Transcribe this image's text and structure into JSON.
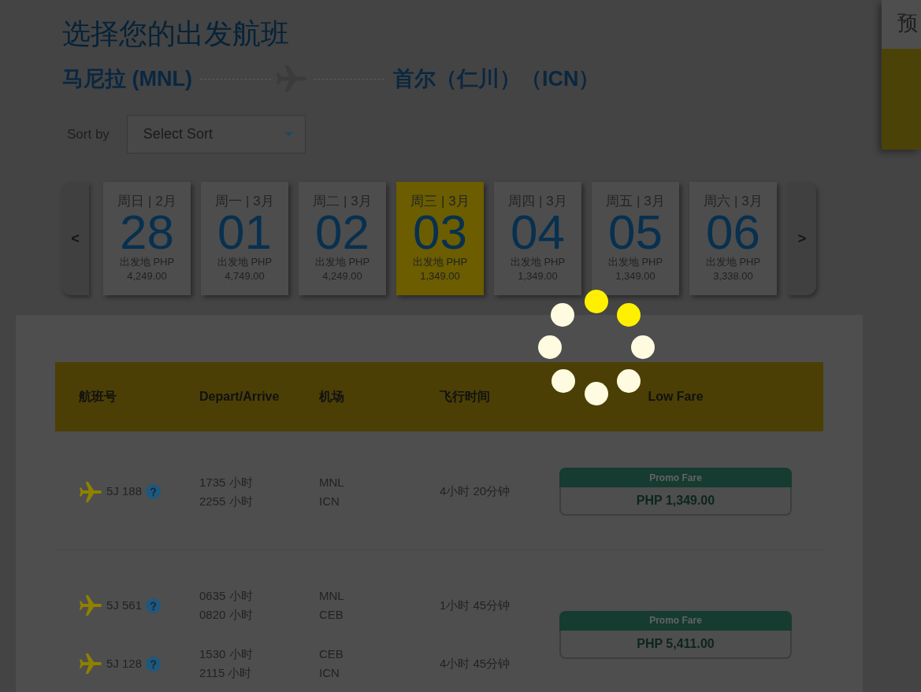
{
  "page_title": "选择您的出发航班",
  "route": {
    "origin": "马尼拉 (MNL)",
    "destination": "首尔（仁川）（ICN）"
  },
  "sort": {
    "label": "Sort by",
    "value": "Select Sort"
  },
  "dates": {
    "prev": "<",
    "next": ">",
    "items": [
      {
        "heading": "周日 | 2月",
        "day": "28",
        "label": "出发地 PHP",
        "price": "4,249.00",
        "selected": false
      },
      {
        "heading": "周一 | 3月",
        "day": "01",
        "label": "出发地 PHP",
        "price": "4,749.00",
        "selected": false
      },
      {
        "heading": "周二 | 3月",
        "day": "02",
        "label": "出发地 PHP",
        "price": "4,249.00",
        "selected": false
      },
      {
        "heading": "周三 | 3月",
        "day": "03",
        "label": "出发地 PHP",
        "price": "1,349.00",
        "selected": true
      },
      {
        "heading": "周四 | 3月",
        "day": "04",
        "label": "出发地 PHP",
        "price": "1,349.00",
        "selected": false
      },
      {
        "heading": "周五 | 3月",
        "day": "05",
        "label": "出发地 PHP",
        "price": "1,349.00",
        "selected": false
      },
      {
        "heading": "周六 | 3月",
        "day": "06",
        "label": "出发地 PHP",
        "price": "3,338.00",
        "selected": false
      }
    ]
  },
  "table": {
    "columns": [
      "航班号",
      "Depart/Arrive",
      "机场",
      "飞行时间",
      "Low Fare"
    ],
    "rows": [
      {
        "segments": [
          {
            "flight": "5J 188",
            "depart": "1735 小时",
            "arrive": "2255 小时",
            "from": "MNL",
            "to": "ICN",
            "duration": "4小时 20分钟"
          }
        ],
        "fare": {
          "label": "Promo Fare",
          "price": "PHP 1,349.00"
        }
      },
      {
        "segments": [
          {
            "flight": "5J 561",
            "depart": "0635 小时",
            "arrive": "0820 小时",
            "from": "MNL",
            "to": "CEB",
            "duration": "1小时 45分钟"
          },
          {
            "flight": "5J 128",
            "depart": "1530 小时",
            "arrive": "2115 小时",
            "from": "CEB",
            "to": "ICN",
            "duration": "4小时 45分钟"
          }
        ],
        "fare": {
          "label": "Promo Fare",
          "price": "PHP 5,411.00"
        }
      }
    ]
  },
  "side_panel": {
    "title": "预"
  },
  "loading": true
}
